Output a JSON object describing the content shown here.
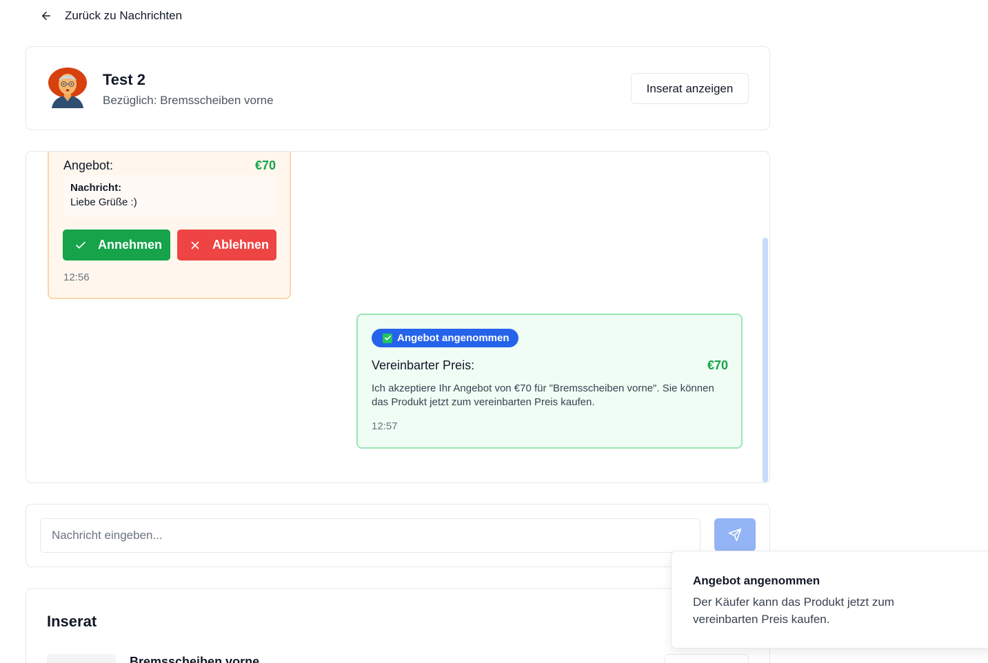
{
  "nav": {
    "back_label": "Zurück zu Nachrichten"
  },
  "header": {
    "title": "Test 2",
    "subtitle": "Bezüglich: Bremsscheiben vorne",
    "view_listing_label": "Inserat anzeigen"
  },
  "chat": {
    "offer": {
      "label": "Angebot:",
      "price": "€70",
      "note_title": "Nachricht:",
      "note_text": "Liebe Grüße :)",
      "accept_label": "Annehmen",
      "decline_label": "Ablehnen",
      "time": "12:56"
    },
    "accepted": {
      "badge": "Angebot angenommen",
      "label": "Vereinbarter Preis:",
      "price": "€70",
      "text": "Ich akzeptiere Ihr Angebot von €70 für \"Bremsscheiben vorne\". Sie können das Produkt jetzt zum vereinbarten Preis kaufen.",
      "time": "12:57"
    }
  },
  "composer": {
    "placeholder": "Nachricht eingeben..."
  },
  "listing": {
    "title": "Inserat",
    "name": "Bremsscheiben vorne"
  },
  "toast": {
    "title": "Angebot angenommen",
    "text": "Der Käufer kann das Produkt jetzt zum vereinbarten Preis kaufen."
  },
  "colors": {
    "accent": "#2563eb",
    "success": "#16a34a",
    "danger": "#ef4444",
    "offer_bg": "#fff7ed",
    "accepted_bg": "#f0fdf4"
  }
}
